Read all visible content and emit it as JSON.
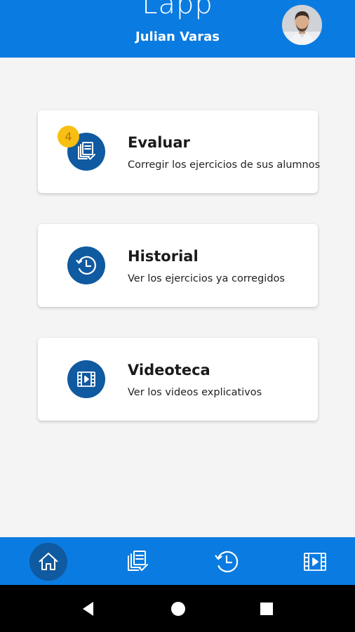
{
  "header": {
    "app_title": "Lapp",
    "user_name": "Julian Varas",
    "avatar_icon": "user-avatar-photo"
  },
  "cards": [
    {
      "title": "Evaluar",
      "subtitle": "Corregir los ejercicios de sus alumnos",
      "icon": "evaluate-docs-check-icon",
      "badge": "4"
    },
    {
      "title": "Historial",
      "subtitle": "Ver los ejercicios ya corregidos",
      "icon": "history-clock-icon"
    },
    {
      "title": "Videoteca",
      "subtitle": "Ver los videos explicativos",
      "icon": "video-film-icon"
    }
  ],
  "tabbar": {
    "items": [
      {
        "icon": "home-icon",
        "active": true
      },
      {
        "icon": "evaluate-docs-check-icon",
        "active": false
      },
      {
        "icon": "history-clock-icon",
        "active": false
      },
      {
        "icon": "video-film-icon",
        "active": false
      }
    ]
  },
  "navbar": {
    "buttons": [
      "back-icon",
      "home-circle-icon",
      "recents-square-icon"
    ]
  },
  "colors": {
    "primary": "#0a7be0",
    "icon_circle": "#0f5aa0",
    "badge": "#f7bf12",
    "background": "#f4f4f4"
  }
}
